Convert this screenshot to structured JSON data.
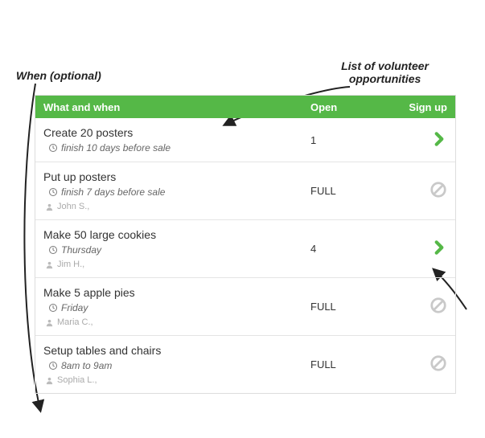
{
  "annotations": {
    "left": "When (optional)",
    "right": "List of volunteer\nopportunities"
  },
  "header": {
    "col_task": "What and when",
    "col_open": "Open",
    "col_sign": "Sign up"
  },
  "rows": [
    {
      "title": "Create 20 posters",
      "when": "finish 10 days before sale",
      "assigned": null,
      "open": "1",
      "available": true
    },
    {
      "title": "Put up posters",
      "when": "finish 7 days before sale",
      "assigned": "John S.,",
      "open": "FULL",
      "available": false
    },
    {
      "title": "Make 50 large cookies",
      "when": "Thursday",
      "assigned": "Jim H.,",
      "open": "4",
      "available": true
    },
    {
      "title": "Make 5 apple pies",
      "when": "Friday",
      "assigned": "Maria C.,",
      "open": "FULL",
      "available": false
    },
    {
      "title": "Setup tables and chairs",
      "when": "8am to 9am",
      "assigned": "Sophia L.,",
      "open": "FULL",
      "available": false
    }
  ]
}
